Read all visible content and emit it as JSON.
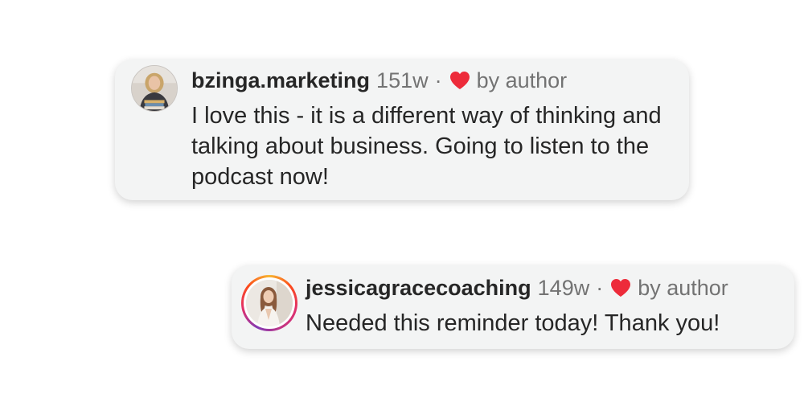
{
  "comments": [
    {
      "username": "bzinga.marketing",
      "age": "151w",
      "separator": "·",
      "like_label": "by author",
      "text": "I love this - it is a different way of thinking and talking about business. Going to listen to the podcast now!",
      "avatar_ring": false
    },
    {
      "username": "jessicagracecoaching",
      "age": "149w",
      "separator": "·",
      "like_label": "by author",
      "text": "Needed this reminder today! Thank you!",
      "avatar_ring": true
    }
  ],
  "icons": {
    "heart": "heart-icon",
    "avatar": "avatar-photo"
  },
  "colors": {
    "heart": "#ed2b3a",
    "card_background": "#f3f4f4",
    "username": "#262626",
    "meta": "#737373",
    "story_ring": [
      "#f7b733",
      "#fc4a1a",
      "#e1306c",
      "#c13584",
      "#833ab4"
    ]
  }
}
